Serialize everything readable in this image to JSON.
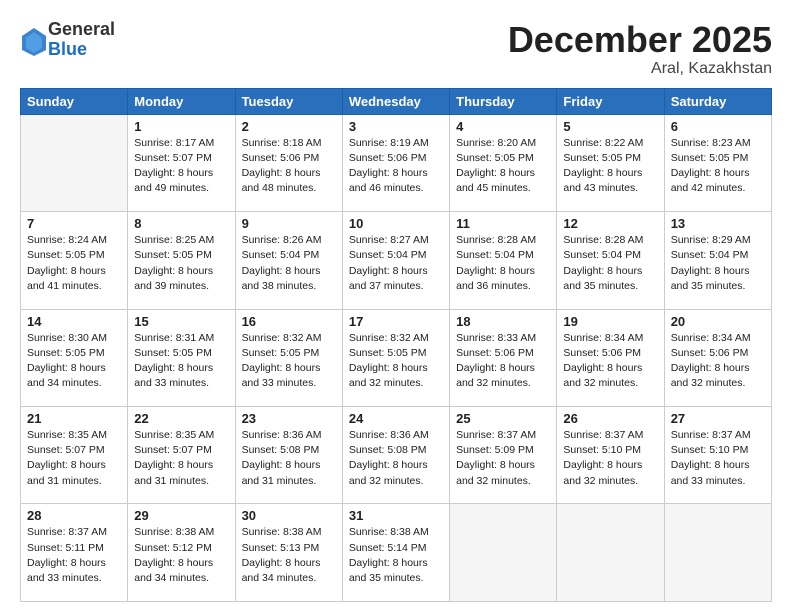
{
  "logo": {
    "general": "General",
    "blue": "Blue"
  },
  "header": {
    "month_title": "December 2025",
    "location": "Aral, Kazakhstan"
  },
  "weekdays": [
    "Sunday",
    "Monday",
    "Tuesday",
    "Wednesday",
    "Thursday",
    "Friday",
    "Saturday"
  ],
  "weeks": [
    [
      {
        "day": "",
        "info": ""
      },
      {
        "day": "1",
        "info": "Sunrise: 8:17 AM\nSunset: 5:07 PM\nDaylight: 8 hours\nand 49 minutes."
      },
      {
        "day": "2",
        "info": "Sunrise: 8:18 AM\nSunset: 5:06 PM\nDaylight: 8 hours\nand 48 minutes."
      },
      {
        "day": "3",
        "info": "Sunrise: 8:19 AM\nSunset: 5:06 PM\nDaylight: 8 hours\nand 46 minutes."
      },
      {
        "day": "4",
        "info": "Sunrise: 8:20 AM\nSunset: 5:05 PM\nDaylight: 8 hours\nand 45 minutes."
      },
      {
        "day": "5",
        "info": "Sunrise: 8:22 AM\nSunset: 5:05 PM\nDaylight: 8 hours\nand 43 minutes."
      },
      {
        "day": "6",
        "info": "Sunrise: 8:23 AM\nSunset: 5:05 PM\nDaylight: 8 hours\nand 42 minutes."
      }
    ],
    [
      {
        "day": "7",
        "info": "Sunrise: 8:24 AM\nSunset: 5:05 PM\nDaylight: 8 hours\nand 41 minutes."
      },
      {
        "day": "8",
        "info": "Sunrise: 8:25 AM\nSunset: 5:05 PM\nDaylight: 8 hours\nand 39 minutes."
      },
      {
        "day": "9",
        "info": "Sunrise: 8:26 AM\nSunset: 5:04 PM\nDaylight: 8 hours\nand 38 minutes."
      },
      {
        "day": "10",
        "info": "Sunrise: 8:27 AM\nSunset: 5:04 PM\nDaylight: 8 hours\nand 37 minutes."
      },
      {
        "day": "11",
        "info": "Sunrise: 8:28 AM\nSunset: 5:04 PM\nDaylight: 8 hours\nand 36 minutes."
      },
      {
        "day": "12",
        "info": "Sunrise: 8:28 AM\nSunset: 5:04 PM\nDaylight: 8 hours\nand 35 minutes."
      },
      {
        "day": "13",
        "info": "Sunrise: 8:29 AM\nSunset: 5:04 PM\nDaylight: 8 hours\nand 35 minutes."
      }
    ],
    [
      {
        "day": "14",
        "info": "Sunrise: 8:30 AM\nSunset: 5:05 PM\nDaylight: 8 hours\nand 34 minutes."
      },
      {
        "day": "15",
        "info": "Sunrise: 8:31 AM\nSunset: 5:05 PM\nDaylight: 8 hours\nand 33 minutes."
      },
      {
        "day": "16",
        "info": "Sunrise: 8:32 AM\nSunset: 5:05 PM\nDaylight: 8 hours\nand 33 minutes."
      },
      {
        "day": "17",
        "info": "Sunrise: 8:32 AM\nSunset: 5:05 PM\nDaylight: 8 hours\nand 32 minutes."
      },
      {
        "day": "18",
        "info": "Sunrise: 8:33 AM\nSunset: 5:06 PM\nDaylight: 8 hours\nand 32 minutes."
      },
      {
        "day": "19",
        "info": "Sunrise: 8:34 AM\nSunset: 5:06 PM\nDaylight: 8 hours\nand 32 minutes."
      },
      {
        "day": "20",
        "info": "Sunrise: 8:34 AM\nSunset: 5:06 PM\nDaylight: 8 hours\nand 32 minutes."
      }
    ],
    [
      {
        "day": "21",
        "info": "Sunrise: 8:35 AM\nSunset: 5:07 PM\nDaylight: 8 hours\nand 31 minutes."
      },
      {
        "day": "22",
        "info": "Sunrise: 8:35 AM\nSunset: 5:07 PM\nDaylight: 8 hours\nand 31 minutes."
      },
      {
        "day": "23",
        "info": "Sunrise: 8:36 AM\nSunset: 5:08 PM\nDaylight: 8 hours\nand 31 minutes."
      },
      {
        "day": "24",
        "info": "Sunrise: 8:36 AM\nSunset: 5:08 PM\nDaylight: 8 hours\nand 32 minutes."
      },
      {
        "day": "25",
        "info": "Sunrise: 8:37 AM\nSunset: 5:09 PM\nDaylight: 8 hours\nand 32 minutes."
      },
      {
        "day": "26",
        "info": "Sunrise: 8:37 AM\nSunset: 5:10 PM\nDaylight: 8 hours\nand 32 minutes."
      },
      {
        "day": "27",
        "info": "Sunrise: 8:37 AM\nSunset: 5:10 PM\nDaylight: 8 hours\nand 33 minutes."
      }
    ],
    [
      {
        "day": "28",
        "info": "Sunrise: 8:37 AM\nSunset: 5:11 PM\nDaylight: 8 hours\nand 33 minutes."
      },
      {
        "day": "29",
        "info": "Sunrise: 8:38 AM\nSunset: 5:12 PM\nDaylight: 8 hours\nand 34 minutes."
      },
      {
        "day": "30",
        "info": "Sunrise: 8:38 AM\nSunset: 5:13 PM\nDaylight: 8 hours\nand 34 minutes."
      },
      {
        "day": "31",
        "info": "Sunrise: 8:38 AM\nSunset: 5:14 PM\nDaylight: 8 hours\nand 35 minutes."
      },
      {
        "day": "",
        "info": ""
      },
      {
        "day": "",
        "info": ""
      },
      {
        "day": "",
        "info": ""
      }
    ]
  ]
}
